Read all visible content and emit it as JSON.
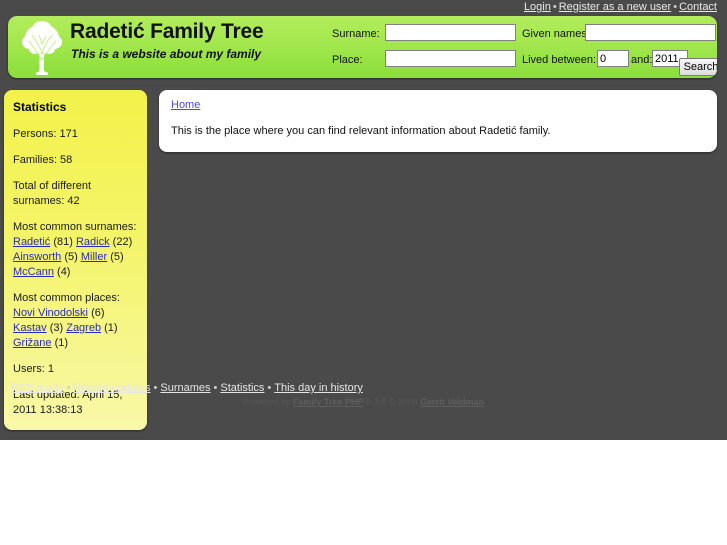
{
  "topnav": {
    "login": "Login",
    "register": "Register as a new user",
    "contact": "Contact",
    "separator": "•"
  },
  "header": {
    "title": "Radetić Family Tree",
    "subtitle": "This is a website about my family",
    "logo_icon": "tree-icon",
    "accent_green": "#a5e84f"
  },
  "search": {
    "surname_label": "Surname:",
    "surname_value": "",
    "given_label": "Given names:",
    "given_value": "",
    "place_label": "Place:",
    "place_value": "",
    "lived_label": "Lived between:",
    "year_from_value": "0",
    "and_label": "and:",
    "year_to_value": "2011",
    "search_button": "Search"
  },
  "sidebar": {
    "heading": "Statistics",
    "persons": "Persons: 171",
    "families": "Families: 58",
    "surnames_total": "Total of different surnames: 42",
    "common_surnames_label": "Most common surnames:",
    "common_surnames": [
      {
        "name": "Radetić",
        "count": "(81)"
      },
      {
        "name": "Radick",
        "count": "(22)"
      },
      {
        "name": "Ainsworth",
        "count": "(5)"
      },
      {
        "name": "Miller",
        "count": "(5)"
      },
      {
        "name": "McCann",
        "count": "(4)"
      }
    ],
    "common_places_label": "Most common places:",
    "common_places": [
      {
        "name": "Novi Vinodolski",
        "count": "(6)"
      },
      {
        "name": "Kastav",
        "count": "(3)"
      },
      {
        "name": "Zagreb",
        "count": "(1)"
      },
      {
        "name": "Grižane",
        "count": "(1)"
      }
    ],
    "users": "Users: 1",
    "last_updated": "Last updated: April 15, 2011 13:38:13",
    "background_yellow": "#f2f24a"
  },
  "content": {
    "breadcrumb": "Home",
    "intro": "This is the place where you can find relevant information about Radetić family."
  },
  "footer": {
    "links": [
      "RSS feeds",
      "Recent updates",
      "Surnames",
      "Statistics",
      "This day in history"
    ],
    "separator": "•",
    "powered_prefix": "Powered by",
    "powered_app": "Family Tree PHP",
    "powered_version": "0.3.8 © 2009",
    "powered_author": "Gerrit Veldman"
  }
}
